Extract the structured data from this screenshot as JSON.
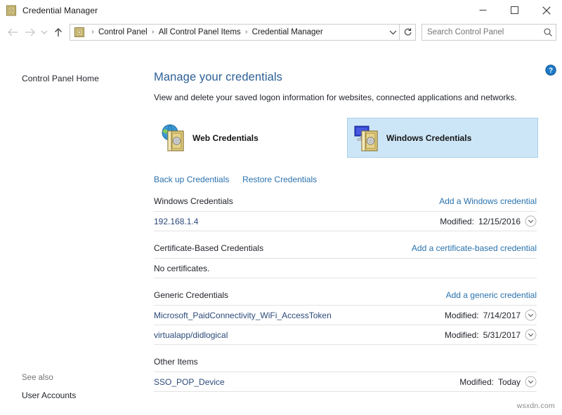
{
  "window": {
    "title": "Credential Manager",
    "icon": "credential-vault-icon",
    "minimize_label": "Minimize",
    "maximize_label": "Maximize",
    "close_label": "Close"
  },
  "navbar": {
    "back_label": "Back",
    "forward_label": "Forward",
    "recent_label": "Recent locations",
    "up_label": "Up one level",
    "breadcrumbs": [
      "Control Panel",
      "All Control Panel Items",
      "Credential Manager"
    ],
    "separator": "›",
    "refresh_label": "Refresh",
    "search": {
      "placeholder": "Search Control Panel",
      "value": ""
    }
  },
  "sidebar": {
    "home_link": "Control Panel Home",
    "see_also_label": "See also",
    "see_also_items": [
      "User Accounts"
    ]
  },
  "main": {
    "help_label": "Help",
    "heading": "Manage your credentials",
    "subtitle": "View and delete your saved logon information for websites, connected applications and networks.",
    "tiles": [
      {
        "label": "Web Credentials",
        "icon": "globe-vault-icon",
        "selected": false
      },
      {
        "label": "Windows Credentials",
        "icon": "monitor-vault-icon",
        "selected": true
      }
    ],
    "actions": [
      {
        "label": "Back up Credentials"
      },
      {
        "label": "Restore Credentials"
      }
    ],
    "modified_label": "Modified:",
    "sections": [
      {
        "title": "Windows Credentials",
        "action": "Add a Windows credential",
        "empty_text": "",
        "rows": [
          {
            "name": "192.168.1.4",
            "modified": "12/15/2016"
          }
        ]
      },
      {
        "title": "Certificate-Based Credentials",
        "action": "Add a certificate-based credential",
        "empty_text": "No certificates.",
        "rows": []
      },
      {
        "title": "Generic Credentials",
        "action": "Add a generic credential",
        "empty_text": "",
        "rows": [
          {
            "name": "Microsoft_PaidConnectivity_WiFi_AccessToken",
            "modified": "7/14/2017"
          },
          {
            "name": "virtualapp/didlogical",
            "modified": "5/31/2017"
          }
        ]
      },
      {
        "title": "Other Items",
        "action": "",
        "empty_text": "",
        "rows": [
          {
            "name": "SSO_POP_Device",
            "modified": "Today"
          }
        ]
      }
    ]
  },
  "watermark": "wsxdn.com",
  "colors": {
    "heading": "#2c5f95",
    "link": "#2a72ad",
    "entry_link": "#2b4a7a",
    "selected_tile_bg": "#cde6f7",
    "selected_tile_border": "#a9cfe8",
    "rule": "#e2e2e2",
    "help_blue": "#1e79c8"
  }
}
